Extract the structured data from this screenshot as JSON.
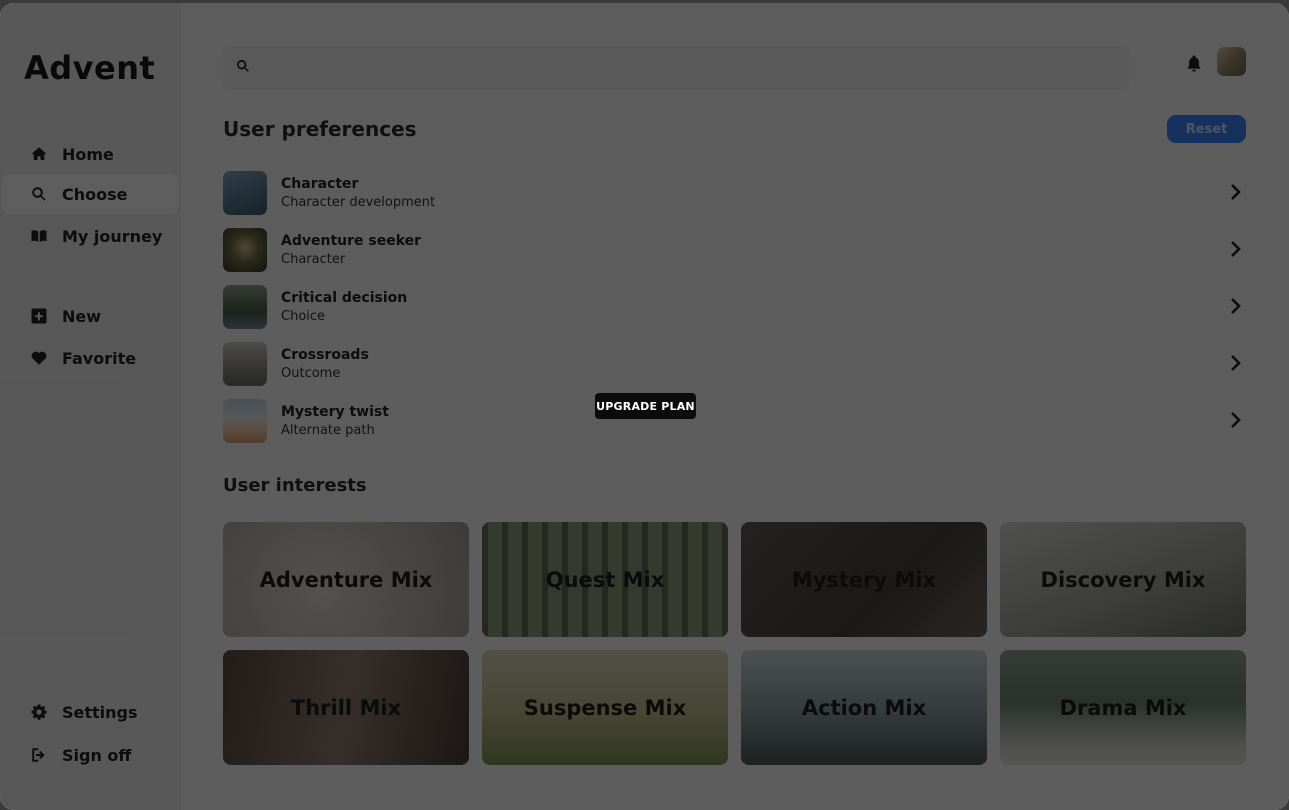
{
  "app": {
    "brand": "Advent"
  },
  "sidebar": {
    "nav_main": [
      {
        "label": "Home",
        "icon": "home-icon"
      },
      {
        "label": "Choose",
        "icon": "search-icon",
        "active": true
      },
      {
        "label": "My journey",
        "icon": "book-icon"
      }
    ],
    "nav_secondary": [
      {
        "label": "New",
        "icon": "plus-square-icon"
      },
      {
        "label": "Favorite",
        "icon": "heart-icon"
      }
    ],
    "nav_bottom": [
      {
        "label": "Settings",
        "icon": "gear-icon"
      },
      {
        "label": "Sign off",
        "icon": "sign-out-icon"
      }
    ]
  },
  "search": {
    "value": "",
    "placeholder": ""
  },
  "preferences": {
    "title": "User preferences",
    "reset_label": "Reset",
    "items": [
      {
        "title": "Character",
        "subtitle": "Character development",
        "thumb_color": "#4f6f86"
      },
      {
        "title": "Adventure seeker",
        "subtitle": "Character",
        "thumb_color": "#6b6a44"
      },
      {
        "title": "Critical decision",
        "subtitle": "Choice",
        "thumb_color": "#5f7257"
      },
      {
        "title": "Crossroads",
        "subtitle": "Outcome",
        "thumb_color": "#8f8c84"
      },
      {
        "title": "Mystery twist",
        "subtitle": "Alternate path",
        "thumb_color": "#9c8f85"
      }
    ]
  },
  "tooltip": {
    "label": "UPGRADE PLAN"
  },
  "interests": {
    "title": "User interests",
    "tiles": [
      {
        "label": "Adventure Mix",
        "color": "#b9b6b1"
      },
      {
        "label": "Quest Mix",
        "color": "#6f7b62"
      },
      {
        "label": "Mystery Mix",
        "color": "#5a5552"
      },
      {
        "label": "Discovery Mix",
        "color": "#a7aaa6"
      },
      {
        "label": "Thrill Mix",
        "color": "#7b6a62"
      },
      {
        "label": "Suspense Mix",
        "color": "#a2a86f"
      },
      {
        "label": "Action Mix",
        "color": "#6d7c7f"
      },
      {
        "label": "Drama Mix",
        "color": "#7a8a7c"
      }
    ]
  },
  "colors": {
    "accent": "#3b82f6",
    "sidebar_bg": "#e6e6e6",
    "main_bg": "#f4f4f4"
  }
}
